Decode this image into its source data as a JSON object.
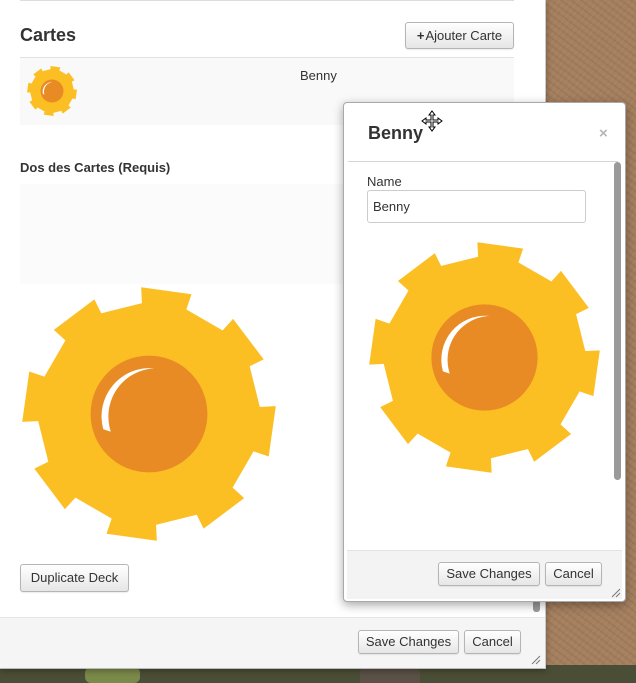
{
  "main": {
    "section_title": "Cartes",
    "add_card_label": "Ajouter Carte",
    "add_card_icon": "+",
    "cards": [
      {
        "name": "Benny"
      }
    ],
    "back_title": "Dos des Cartes (Requis)",
    "duplicate_label": "Duplicate Deck",
    "save_label": "Save Changes",
    "cancel_label": "Cancel"
  },
  "card_dialog": {
    "title": "Benny",
    "close_icon": "×",
    "name_label": "Name",
    "name_value": "Benny",
    "save_label": "Save Changes",
    "cancel_label": "Cancel"
  },
  "colors": {
    "sun_ray": "#fbbf24",
    "sun_core": "#e98b24",
    "sun_highlight": "#ffffff"
  }
}
